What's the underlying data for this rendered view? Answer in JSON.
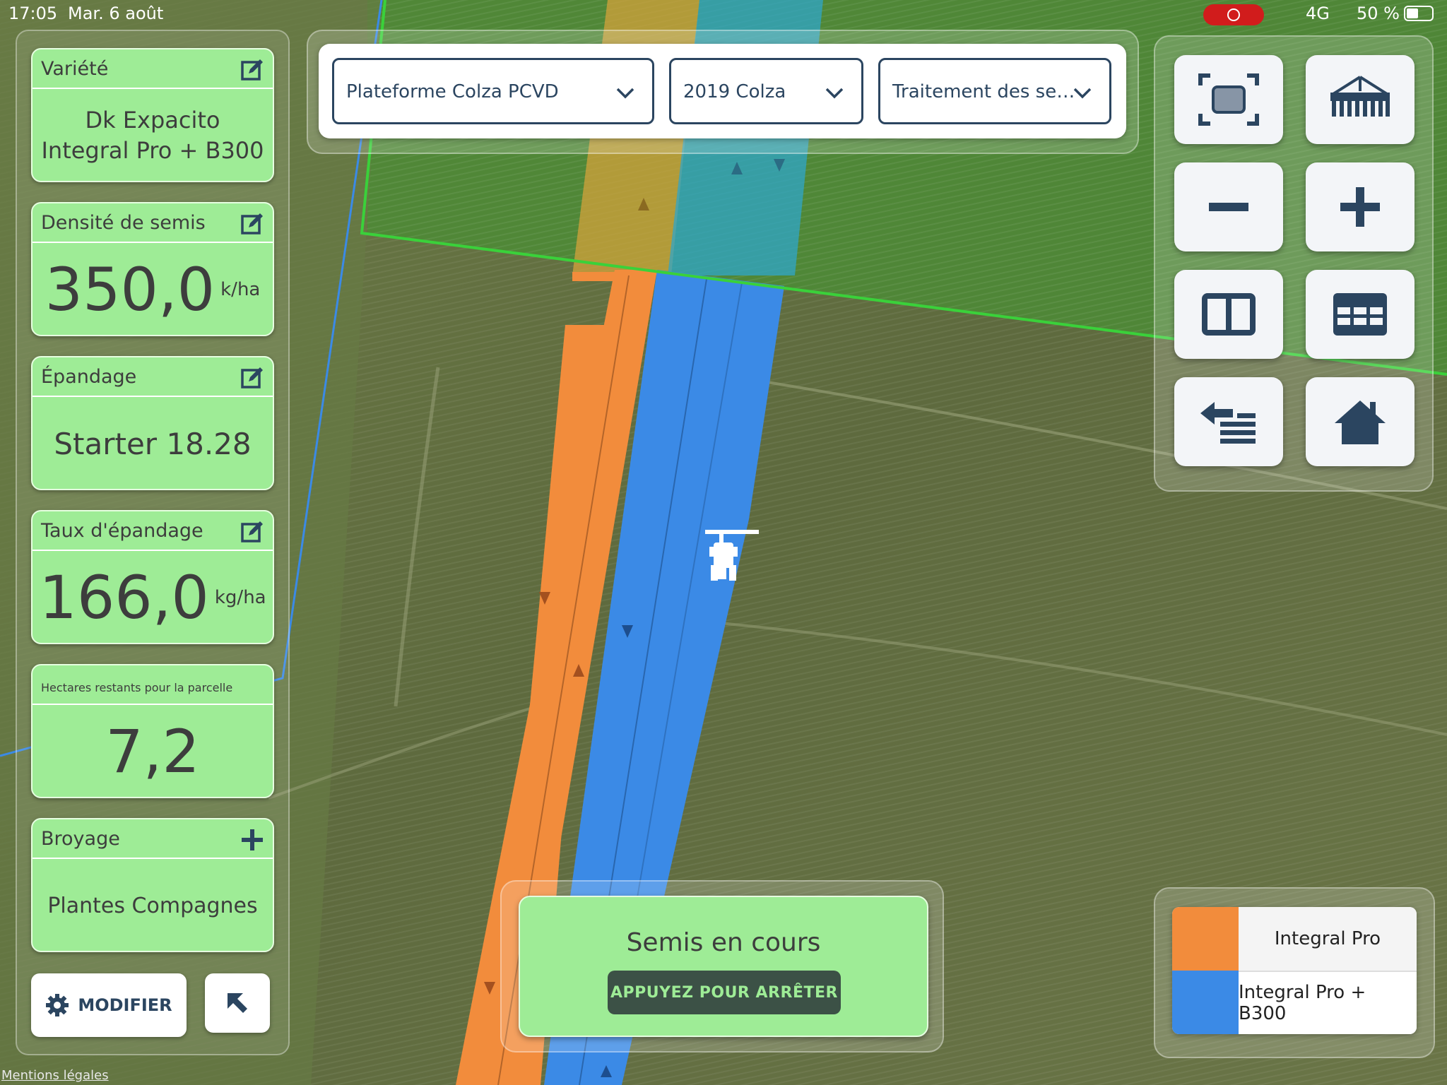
{
  "status_bar": {
    "time": "17:05",
    "date": "Mar. 6 août",
    "network": "4G",
    "battery": "50 %",
    "recording_color": "#d11c1c"
  },
  "cards": {
    "variete": {
      "title": "Variété",
      "line1": "Dk Expacito",
      "line2": "Integral Pro + B300",
      "icon": "edit-icon"
    },
    "densite": {
      "title": "Densité de semis",
      "value": "350,0",
      "unit": "k/ha",
      "icon": "edit-icon"
    },
    "epandage": {
      "title": "Épandage",
      "value": "Starter 18.28",
      "icon": "edit-icon"
    },
    "taux": {
      "title": "Taux d'épandage",
      "value": "166,0",
      "unit": "kg/ha",
      "icon": "edit-icon"
    },
    "hectares": {
      "title": "Hectares restants pour la parcelle",
      "value": "7,2"
    },
    "broyage": {
      "title": "Broyage",
      "value": "Plantes Compagnes",
      "icon": "plus-icon"
    }
  },
  "buttons": {
    "modifier": "MODIFIER"
  },
  "dropdowns": {
    "farm": "Plateforme Colza PCVD",
    "campaign": "2019 Colza",
    "task": "Traitement des se…"
  },
  "status_button": {
    "title": "Semis en cours",
    "action": "APPUYEZ POUR ARRÊTER"
  },
  "legend": [
    {
      "label": "Integral Pro",
      "color": "#f28c3c"
    },
    {
      "label": "Integral Pro + B300",
      "color": "#3b8ae6"
    }
  ],
  "footer": {
    "legal": "Mentions légales"
  },
  "colors": {
    "card_green": "#9eec96",
    "navy": "#2b4560",
    "field_boundary": "#3ad13a"
  }
}
